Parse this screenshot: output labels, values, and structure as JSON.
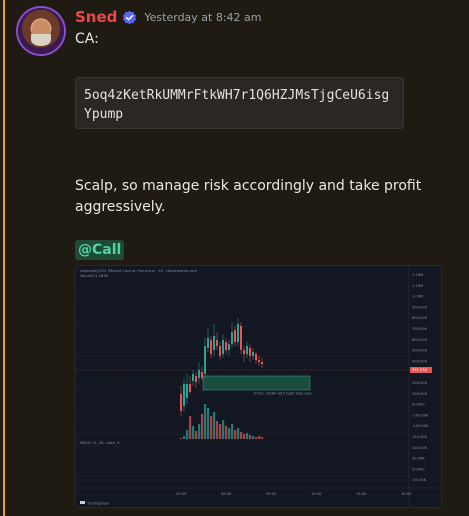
{
  "message": {
    "username": "Sned",
    "timestamp": "Yesterday at 8:42 am",
    "ca_label": "CA:",
    "contract_address": "5oq4zKetRkUMMrFtkWH7r1Q6HZJMsTjgCeU6isgYpump",
    "body_text": "Scalp, so manage risk accordingly and take profit aggressively.",
    "mention": "@Call"
  },
  "chart": {
    "header_text": "singleplay/SOL (Market Cap) on Pump.fun · 1S · dexscreener.com",
    "volume_label": "Volume",
    "volume_value": "71.183K",
    "indicator_label": "MACD 12, 26, close, 9",
    "zone_annotation": "Entry, 10/80 with tight stop loss",
    "price_badge": "591.53K",
    "y_axis_ticks": [
      "1.20M",
      "1.10M",
      "1.00M",
      "900.00K",
      "800.00K",
      "700.00K",
      "600.00K",
      "500.00K",
      "400.00K",
      "300.00K",
      "200.00K",
      "100.00K",
      "0.0000",
      "-100.00K",
      "-200.00K",
      "150.00K",
      "100.00K",
      "50.00K",
      "0.0000",
      "-50.00K"
    ],
    "x_axis_ticks": [
      "03:30",
      "06:00",
      "09:00",
      "12:00",
      "15:00",
      "18:00"
    ],
    "watermark": "TradingView",
    "colors": {
      "up": "#26a69a",
      "down": "#ef5350",
      "zone": "#1b4d3e"
    }
  },
  "colors": {
    "username": "#f04747",
    "mention_bg": "#1f4a38",
    "mention_text": "#4fd6a0",
    "accent": "#e0a43a"
  },
  "icons": {
    "verified": "verified-badge-icon"
  }
}
